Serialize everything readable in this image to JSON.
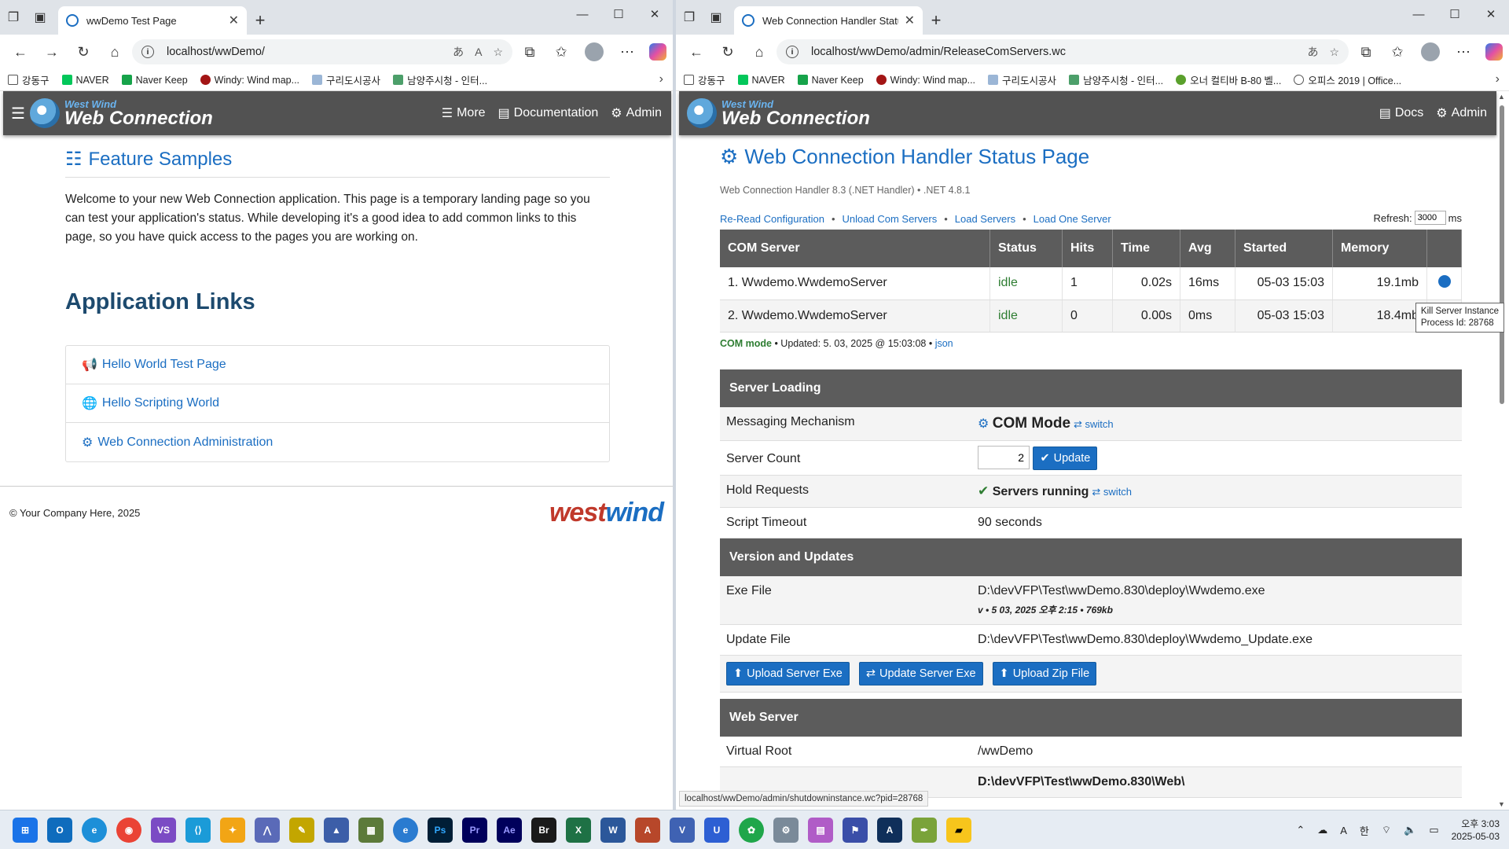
{
  "left": {
    "tab_title": "wwDemo Test Page",
    "url": "localhost/wwDemo/",
    "bookmarks": [
      "강동구",
      "NAVER",
      "Naver Keep",
      "Windy: Wind map...",
      "구리도시공사",
      "남양주시청 - 인터..."
    ],
    "header": {
      "brand_top": "West Wind",
      "brand_main": "Web Connection",
      "nav_more": "More",
      "nav_docs": "Documentation",
      "nav_admin": "Admin"
    },
    "page": {
      "title": "Feature Samples",
      "welcome": "Welcome to your new Web Connection application. This page is a temporary landing page so you can test your application's status. While developing it's a good idea to add common links to this page, so you have quick access to the pages you are working on.",
      "links_title": "Application Links",
      "links": [
        "Hello World Test Page",
        "Hello Scripting World",
        "Web Connection Administration"
      ],
      "footer": "© Your Company Here, 2025",
      "footer_logo_a": "west",
      "footer_logo_b": "wind"
    }
  },
  "right": {
    "tab_title": "Web Connection Handler Status P",
    "url": "localhost/wwDemo/admin/ReleaseComServers.wc",
    "bookmarks": [
      "강동구",
      "NAVER",
      "Naver Keep",
      "Windy: Wind map...",
      "구리도시공사",
      "남양주시청 - 인터...",
      "오너 컬티바 B-80 벨...",
      "오피스 2019 | Office..."
    ],
    "header": {
      "brand_top": "West Wind",
      "brand_main": "Web Connection",
      "nav_docs": "Docs",
      "nav_admin": "Admin"
    },
    "page": {
      "title": "Web Connection Handler Status Page",
      "version": "Web Connection Handler 8.3 (.NET Handler) • .NET 4.8.1",
      "actions": [
        "Re-Read Configuration",
        "Unload Com Servers",
        "Load Servers",
        "Load One Server"
      ],
      "refresh_label": "Refresh:",
      "refresh_value": "3000",
      "refresh_unit": "ms",
      "table_headers": [
        "COM Server",
        "Status",
        "Hits",
        "Time",
        "Avg",
        "Started",
        "Memory",
        ""
      ],
      "servers": [
        [
          "1.  Wwdemo.WwdemoServer",
          "idle",
          "1",
          "0.02s",
          "16ms",
          "05-03 15:03",
          "19.1mb"
        ],
        [
          "2.  Wwdemo.WwdemoServer",
          "idle",
          "0",
          "0.00s",
          "0ms",
          "05-03 15:03",
          "18.4mb"
        ]
      ],
      "tooltip_line1": "Kill Server Instance",
      "tooltip_line2": "Process Id: 28768",
      "mode_label": "COM mode",
      "mode_updated": " • Updated: 5. 03, 2025 @ 15:03:08 • ",
      "mode_json": "json",
      "server_loading": {
        "title": "Server Loading",
        "messaging_label": "Messaging Mechanism",
        "messaging_value": "COM Mode",
        "switch": "switch",
        "count_label": "Server Count",
        "count_value": "2",
        "update_btn": "Update",
        "hold_label": "Hold Requests",
        "hold_value": "Servers running",
        "timeout_label": "Script Timeout",
        "timeout_value": "90 seconds"
      },
      "versions": {
        "title": "Version and Updates",
        "exe_label": "Exe File",
        "exe_value": "D:\\devVFP\\Test\\wwDemo.830\\deploy\\Wwdemo.exe",
        "exe_meta": "v  •  5 03, 2025 오후 2:15  •  769kb",
        "update_label": "Update File",
        "update_value": "D:\\devVFP\\Test\\wwDemo.830\\deploy\\Wwdemo_Update.exe",
        "btn_upload": "Upload Server Exe",
        "btn_update": "Update Server Exe",
        "btn_zip": "Upload Zip File"
      },
      "webserver": {
        "title": "Web Server",
        "vroot_label": "Virtual Root",
        "vroot_value": "/wwDemo",
        "next_value": "D:\\devVFP\\Test\\wwDemo.830\\Web\\"
      },
      "status_url": "localhost/wwDemo/admin/shutdowninstance.wc?pid=28768"
    }
  },
  "taskbar": {
    "clock_time": "오후 3:03",
    "clock_date": "2025-05-03",
    "ime_a": "A",
    "ime_ko": "한"
  },
  "colors": {
    "accent": "#1b6ec2",
    "header_bg": "#525252",
    "ok_green": "#2e7d32"
  }
}
